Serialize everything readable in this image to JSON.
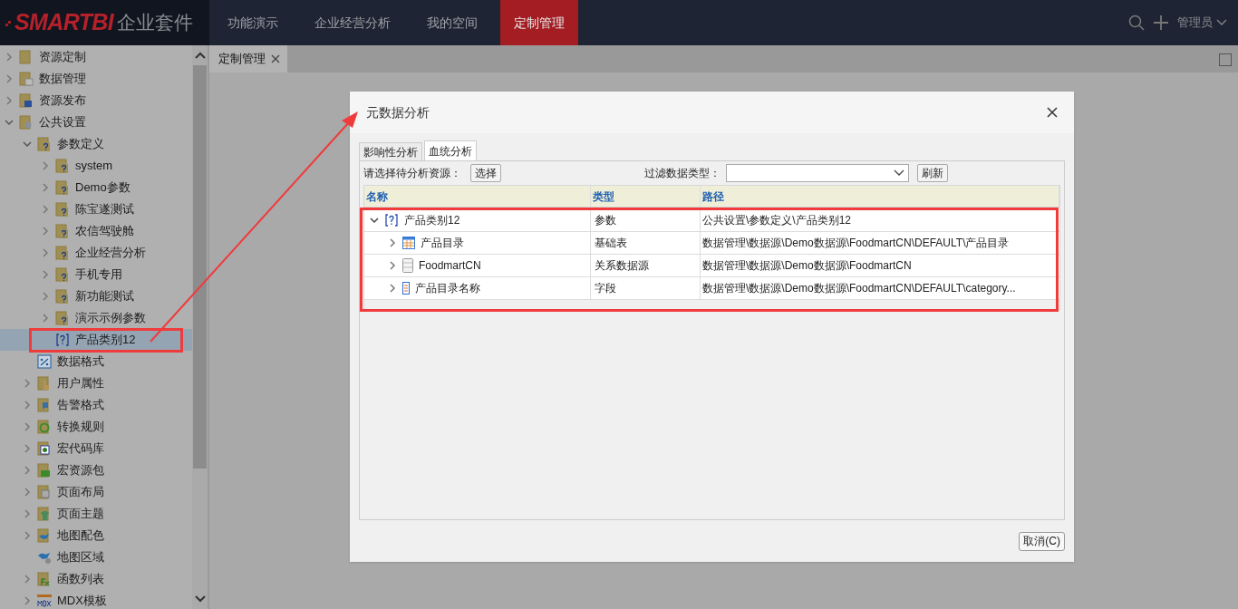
{
  "header": {
    "logo_brand": "SMARTBI",
    "logo_suffix": "企业套件",
    "nav": [
      {
        "label": "功能演示",
        "selected": false
      },
      {
        "label": "企业经营分析",
        "selected": false
      },
      {
        "label": "我的空间",
        "selected": false
      },
      {
        "label": "定制管理",
        "selected": true
      }
    ],
    "user": "管理员"
  },
  "sidebar": {
    "items": [
      {
        "label": "资源定制",
        "kind": "branch",
        "expanded": false,
        "selected": false
      },
      {
        "label": "数据管理",
        "kind": "branch",
        "expanded": false,
        "selected": false
      },
      {
        "label": "资源发布",
        "kind": "branch",
        "expanded": false,
        "selected": false
      },
      {
        "label": "公共设置",
        "kind": "branch",
        "expanded": true,
        "selected": false,
        "children": [
          {
            "label": "参数定义",
            "kind": "branch",
            "expanded": true,
            "selected": false,
            "children": [
              {
                "label": "system",
                "kind": "branch",
                "expanded": false,
                "selected": false
              },
              {
                "label": "Demo参数",
                "kind": "branch",
                "expanded": false,
                "selected": false
              },
              {
                "label": "陈宝遂测试",
                "kind": "branch",
                "expanded": false,
                "selected": false
              },
              {
                "label": "农信驾驶舱",
                "kind": "branch",
                "expanded": false,
                "selected": false
              },
              {
                "label": "企业经营分析",
                "kind": "branch",
                "expanded": false,
                "selected": false
              },
              {
                "label": "手机专用",
                "kind": "branch",
                "expanded": false,
                "selected": false
              },
              {
                "label": "新功能测试",
                "kind": "branch",
                "expanded": false,
                "selected": false
              },
              {
                "label": "演示示例参数",
                "kind": "branch",
                "expanded": false,
                "selected": false
              },
              {
                "label": "产品类别12",
                "kind": "leaf",
                "selected": true
              }
            ]
          },
          {
            "label": "数据格式",
            "kind": "leaf",
            "selected": false
          },
          {
            "label": "用户属性",
            "kind": "branch",
            "expanded": false,
            "selected": false
          },
          {
            "label": "告警格式",
            "kind": "branch",
            "expanded": false,
            "selected": false
          },
          {
            "label": "转换规则",
            "kind": "branch",
            "expanded": false,
            "selected": false
          },
          {
            "label": "宏代码库",
            "kind": "branch",
            "expanded": false,
            "selected": false
          },
          {
            "label": "宏资源包",
            "kind": "branch",
            "expanded": false,
            "selected": false
          },
          {
            "label": "页面布局",
            "kind": "branch",
            "expanded": false,
            "selected": false
          },
          {
            "label": "页面主题",
            "kind": "branch",
            "expanded": false,
            "selected": false
          },
          {
            "label": "地图配色",
            "kind": "branch",
            "expanded": false,
            "selected": false
          },
          {
            "label": "地图区域",
            "kind": "leaf",
            "selected": false
          },
          {
            "label": "函数列表",
            "kind": "branch",
            "expanded": false,
            "selected": false
          },
          {
            "label": "MDX模板",
            "kind": "branch",
            "expanded": false,
            "selected": false
          }
        ]
      }
    ]
  },
  "tab_bar": {
    "tabs": [
      {
        "label": "定制管理",
        "selected": true
      }
    ]
  },
  "dialog": {
    "title": "元数据分析",
    "tabs": [
      {
        "label": "影响性分析",
        "selected": false
      },
      {
        "label": "血统分析",
        "selected": true
      }
    ],
    "resource_label": "请选择待分析资源：",
    "select_button": "选择",
    "filter_label": "过滤数据类型：",
    "refresh_button": "刷新",
    "table": {
      "columns": [
        "名称",
        "类型",
        "路径"
      ],
      "rows": [
        {
          "name": "产品类别12",
          "kind": "parameter",
          "type": "参数",
          "path": "公共设置\\参数定义\\产品类别12",
          "expanded": true,
          "children": [
            {
              "name": "产品目录",
              "kind": "table",
              "type": "基础表",
              "path": "数据管理\\数据源\\Demo数据源\\FoodmartCN\\DEFAULT\\产品目录",
              "expanded": false
            },
            {
              "name": "FoodmartCN",
              "kind": "datasource",
              "type": "关系数据源",
              "path": "数据管理\\数据源\\Demo数据源\\FoodmartCN",
              "expanded": false
            },
            {
              "name": "产品目录名称",
              "kind": "field",
              "type": "字段",
              "path": "数据管理\\数据源\\Demo数据源\\FoodmartCN\\DEFAULT\\category...",
              "expanded": false
            }
          ]
        }
      ]
    },
    "cancel_button": "取消(C)"
  }
}
